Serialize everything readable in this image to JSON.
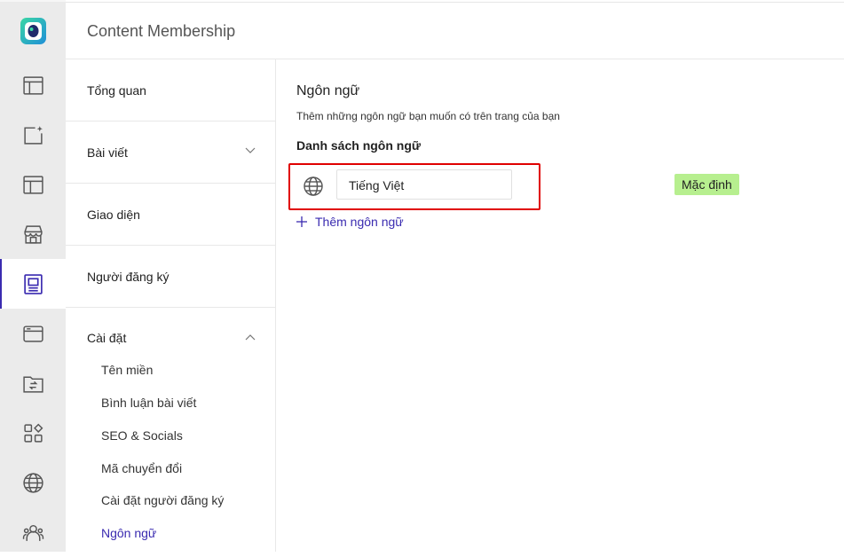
{
  "header": {
    "title": "Content Membership"
  },
  "rail": {
    "icons": [
      "dashboard-icon",
      "add-post-icon",
      "layout-icon",
      "store-icon",
      "membership-icon",
      "browser-icon",
      "folder-sync-icon",
      "apps-icon",
      "globe-icon",
      "users-icon"
    ],
    "active": "membership-icon"
  },
  "subnav": {
    "overview": "Tổng quan",
    "posts": "Bài viết",
    "appearance": "Giao diện",
    "subscribers": "Người đăng ký",
    "settings": "Cài đặt",
    "settings_items": [
      "Tên miền",
      "Bình luận bài viết",
      "SEO & Socials",
      "Mã chuyển đổi",
      "Cài đặt người đăng ký",
      "Ngôn ngữ"
    ]
  },
  "main": {
    "title": "Ngôn ngữ",
    "description": "Thêm những ngôn ngữ bạn muốn có trên trang của bạn",
    "list_title": "Danh sách ngôn ngữ",
    "languages": [
      {
        "name": "Tiếng Việt",
        "badge": "Mặc định"
      }
    ],
    "add_label": "Thêm ngôn ngữ"
  },
  "colors": {
    "accent": "#3a2bb0",
    "highlight_border": "#e00000",
    "badge_bg": "#b7ef8f"
  }
}
